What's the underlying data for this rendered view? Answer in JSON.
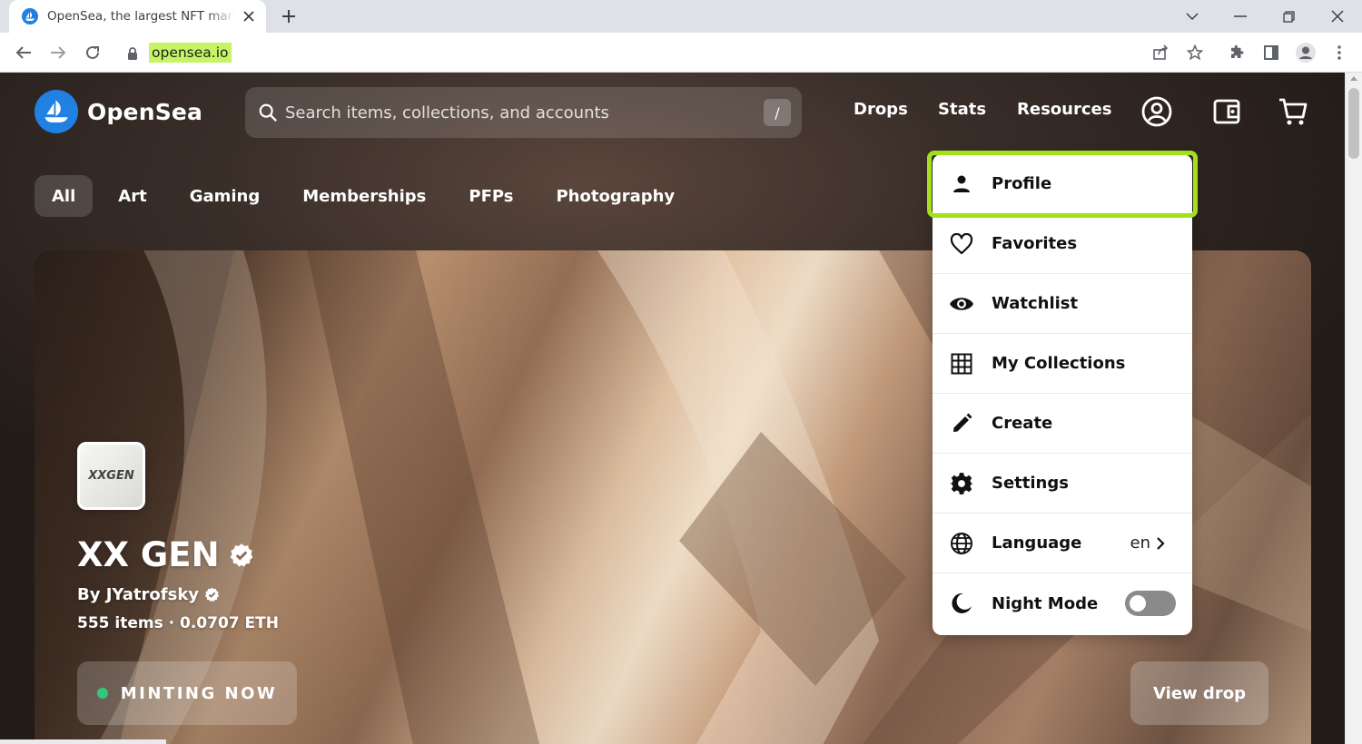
{
  "browser": {
    "tab_title": "OpenSea, the largest NFT marketplace",
    "url": "opensea.io"
  },
  "header": {
    "brand": "OpenSea",
    "search_placeholder": "Search items, collections, and accounts",
    "search_shortcut": "/",
    "nav": [
      "Drops",
      "Stats",
      "Resources"
    ]
  },
  "categories": [
    "All",
    "Art",
    "Gaming",
    "Memberships",
    "PFPs",
    "Photography"
  ],
  "hero": {
    "logo_text": "XXGEN",
    "title": "XX GEN",
    "by": "By JYatrofsky",
    "stats": "555 items · 0.0707 ETH",
    "minting": "MINTING NOW",
    "view_drop": "View drop"
  },
  "menu": {
    "items": [
      {
        "label": "Profile",
        "icon": "person-icon"
      },
      {
        "label": "Favorites",
        "icon": "heart-icon"
      },
      {
        "label": "Watchlist",
        "icon": "eye-icon"
      },
      {
        "label": "My Collections",
        "icon": "grid-icon"
      },
      {
        "label": "Create",
        "icon": "pencil-icon"
      },
      {
        "label": "Settings",
        "icon": "gear-icon"
      },
      {
        "label": "Language",
        "icon": "globe-icon",
        "value": "en"
      },
      {
        "label": "Night Mode",
        "icon": "moon-icon",
        "toggle": false
      }
    ]
  },
  "colors": {
    "brand_blue": "#2081e2",
    "highlight": "#a3e01b",
    "url_highlight": "#c7f464"
  }
}
